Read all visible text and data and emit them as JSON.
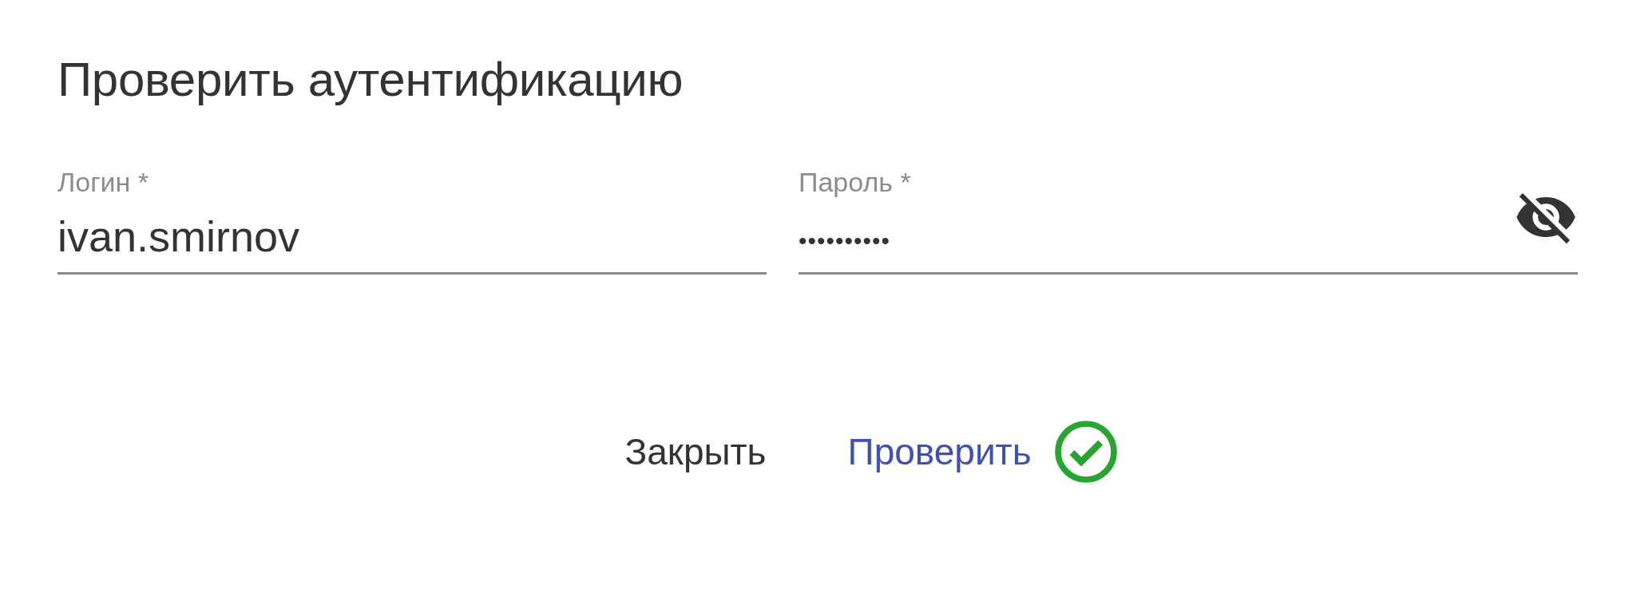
{
  "dialog": {
    "title": "Проверить аутентификацию"
  },
  "fields": [
    {
      "kind": "text",
      "label": "Логин *",
      "value": "ivan.smirnov"
    },
    {
      "kind": "password",
      "label": "Пароль *",
      "value": "••••••••••",
      "password_visible": false
    }
  ],
  "buttons": [
    {
      "kind": "close",
      "label": "Закрыть"
    },
    {
      "kind": "primary",
      "label": "Проверить",
      "verified": true
    }
  ]
}
